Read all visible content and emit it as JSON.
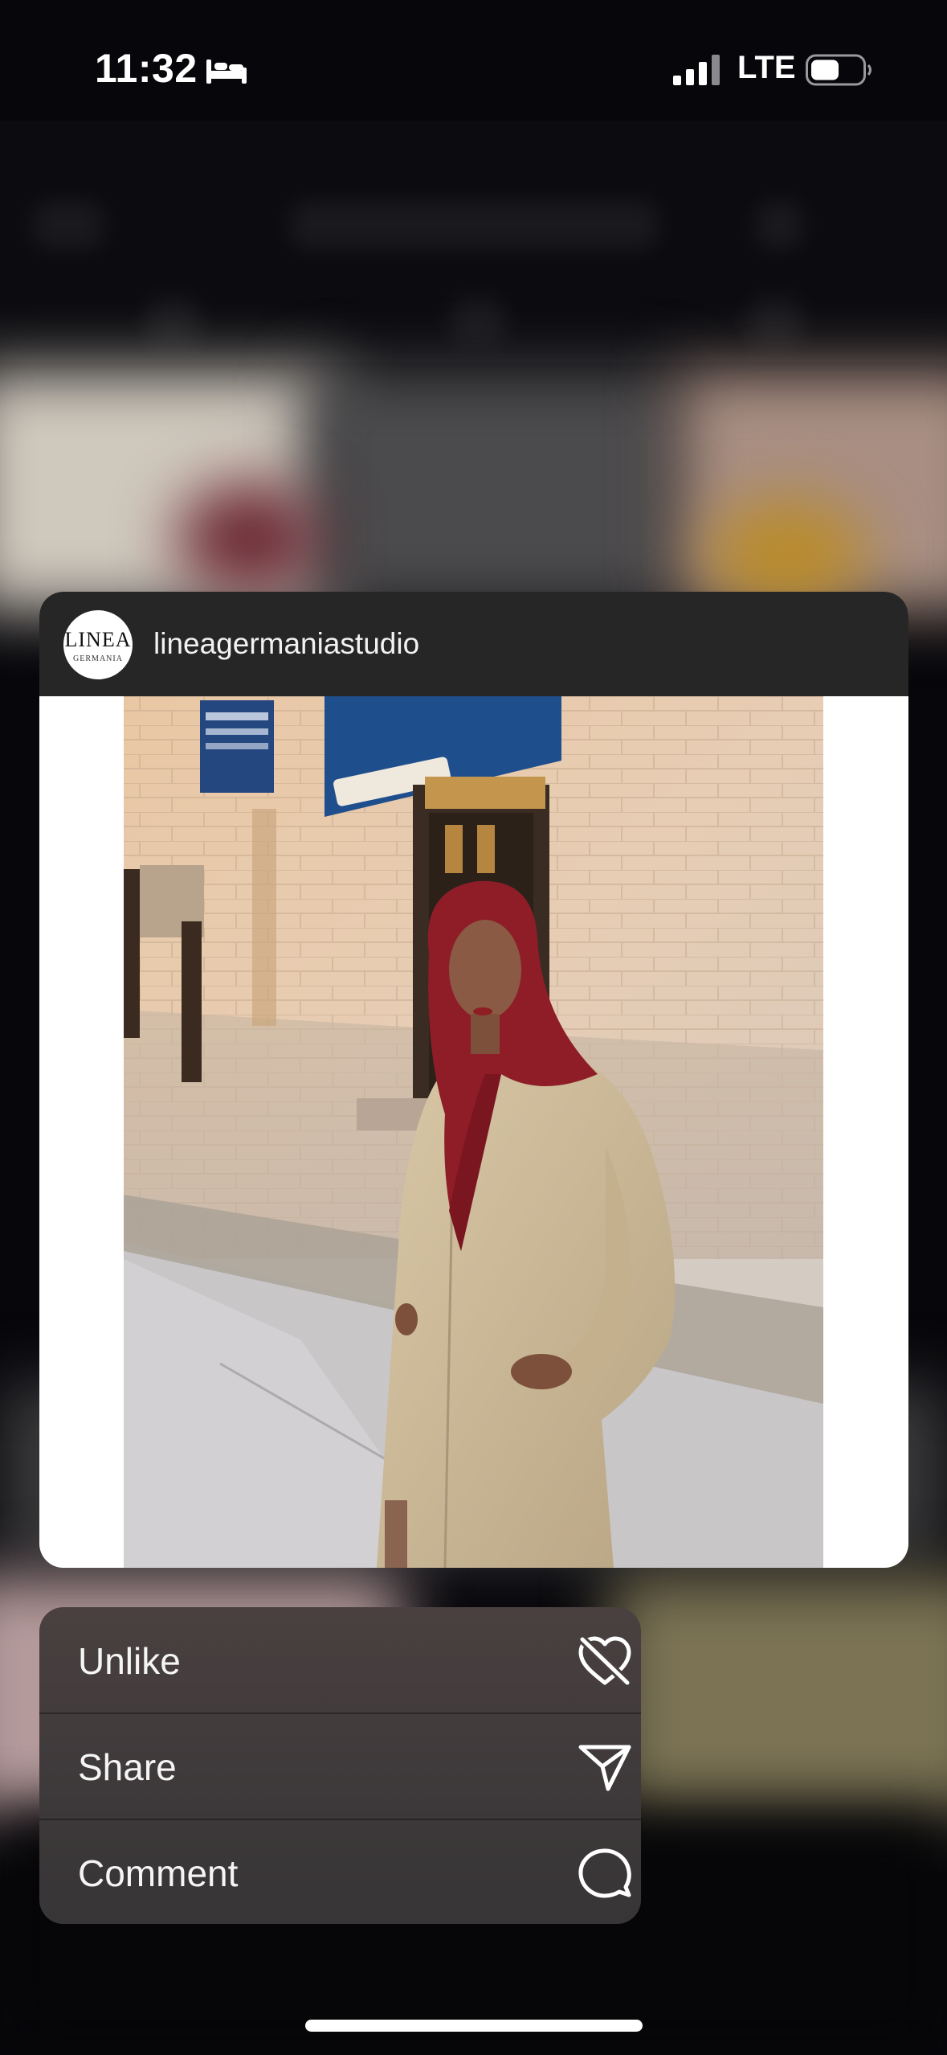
{
  "status_bar": {
    "time": "11:32",
    "network": "LTE",
    "icons": [
      "bed-icon",
      "signal-icon",
      "battery-icon"
    ]
  },
  "post": {
    "username": "lineagermaniastudio",
    "avatar": {
      "logo_text": "LINEA",
      "logo_subtext": "GERMANIA",
      "icon": "avatar"
    },
    "image_description_icon": "post-photo"
  },
  "context_menu": {
    "items": [
      {
        "label": "Unlike",
        "icon": "heart-slash-icon"
      },
      {
        "label": "Share",
        "icon": "paper-plane-icon"
      },
      {
        "label": "Comment",
        "icon": "speech-bubble-icon"
      }
    ]
  },
  "colors": {
    "card_header": "#262626",
    "menu_top": "#4a4040",
    "menu_bottom": "#373536",
    "scarf_red": "#8e1d28",
    "coat_beige": "#cbb897"
  }
}
